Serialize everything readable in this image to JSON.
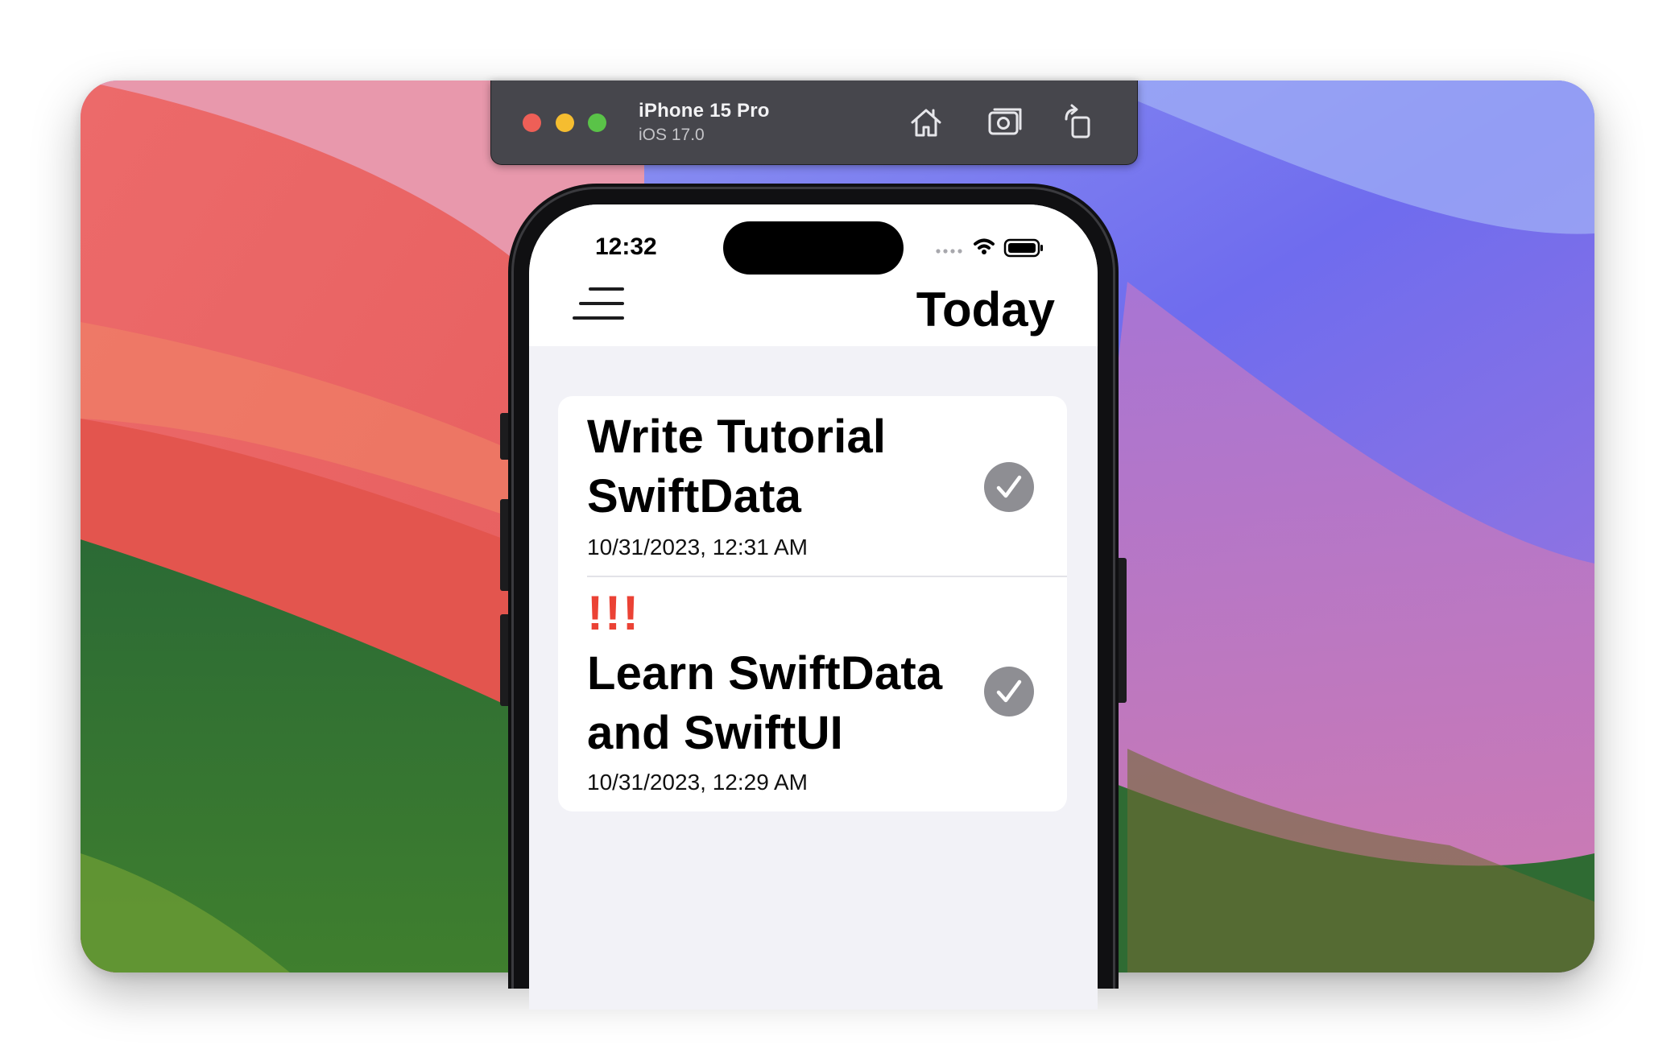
{
  "simulator": {
    "device_name": "iPhone 15 Pro",
    "os_version": "iOS 17.0",
    "toolbar_icons": [
      "home-icon",
      "screenshot-icon",
      "rotate-icon"
    ]
  },
  "status_bar": {
    "time": "12:32",
    "icons": [
      "cellular-dots-icon",
      "wifi-icon",
      "battery-icon"
    ]
  },
  "nav": {
    "title": "Today",
    "menu_icon": "menu-lines-icon"
  },
  "tasks": [
    {
      "title": "Write Tutorial SwiftData",
      "date": "10/31/2023, 12:31 AM",
      "priority": "",
      "completed_icon": "checkmark-circle-icon"
    },
    {
      "title": "Learn SwiftData and SwiftUI",
      "date": "10/31/2023, 12:29 AM",
      "priority": "!!!",
      "completed_icon": "checkmark-circle-icon"
    }
  ],
  "colors": {
    "priority_red": "#eb4235",
    "check_gray": "#8e8e93",
    "toolbar_bg": "#46464c",
    "list_bg": "#f2f2f7"
  }
}
